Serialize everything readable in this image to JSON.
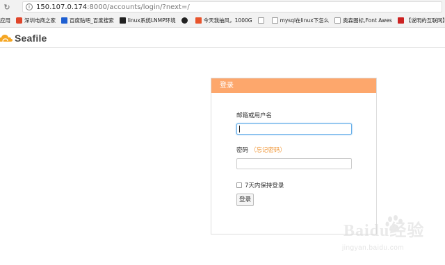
{
  "browser": {
    "url_host": "150.107.0.174",
    "url_rest": ":8000/accounts/login/?next=/",
    "bookmarks": [
      {
        "label": "应用",
        "icon": "apps-icon"
      },
      {
        "label": "深圳电商之家",
        "icon": "d-logo-icon"
      },
      {
        "label": "百度贴吧_百度搜索",
        "icon": "tieba-icon"
      },
      {
        "label": "linux系统LNMP环境",
        "icon": "terminal-icon"
      },
      {
        "label": "",
        "icon": "github-icon"
      },
      {
        "label": "今天我抽风，1000G",
        "icon": "windmill-icon"
      },
      {
        "label": "",
        "icon": "page-icon"
      },
      {
        "label": "mysql在linux下怎么",
        "icon": "page-icon"
      },
      {
        "label": "奥森图标,Font Awes",
        "icon": "page-icon"
      },
      {
        "label": "【说明的互联网】",
        "icon": "red-square-icon"
      }
    ]
  },
  "header": {
    "logo_text": "Seafile"
  },
  "login": {
    "title": "登录",
    "username_label": "邮箱或用户名",
    "username_value": "",
    "password_label": "密码",
    "forgot_link": "（忘记密码）",
    "password_value": "",
    "remember_label": "7天内保持登录",
    "submit_label": "登录"
  },
  "watermark": {
    "main": "Baidu经验",
    "sub": "jingyan.baidu.com"
  },
  "colors": {
    "panel_header": "#fda76c",
    "forgot_link": "#f09a3e",
    "focus_border": "#66afe9"
  }
}
